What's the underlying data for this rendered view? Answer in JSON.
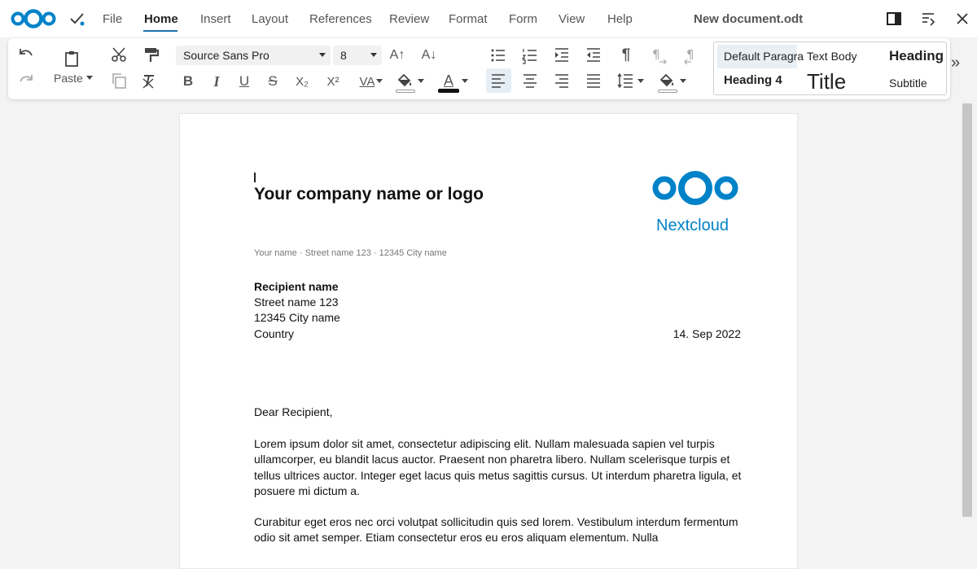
{
  "menubar": {
    "items": [
      {
        "label": "File"
      },
      {
        "label": "Home"
      },
      {
        "label": "Insert"
      },
      {
        "label": "Layout"
      },
      {
        "label": "References"
      },
      {
        "label": "Review"
      },
      {
        "label": "Format"
      },
      {
        "label": "Form"
      },
      {
        "label": "View"
      },
      {
        "label": "Help"
      }
    ],
    "active_tab": "Home",
    "document_title": "New document.odt"
  },
  "toolbar": {
    "paste_label": "Paste",
    "font_name": "Source Sans Pro",
    "font_size": "8",
    "bold_label": "B",
    "italic_label": "I",
    "underline_label": "U",
    "strike_label": "S",
    "subscript_label": "X₂",
    "superscript_label": "X²",
    "spacing_label": "VA",
    "font_color_label": "A",
    "grow_label": "A↑",
    "shrink_label": "A↓",
    "pilcrow_label": "¶"
  },
  "styles": {
    "items": [
      "Default Paragraph",
      "Text Body",
      "Heading",
      "Heading 4",
      "Title",
      "Subtitle"
    ]
  },
  "document": {
    "company": "Your company name or logo",
    "logo_text": "Nextcloud",
    "sender_line": "Your name  ·  Street name 123  ·  12345 City name",
    "recipient": {
      "name": "Recipient name",
      "street": "Street name 123",
      "city": "12345 City name",
      "country": "Country"
    },
    "date": "14. Sep 2022",
    "greeting": "Dear Recipient,",
    "paragraph1": "Lorem ipsum dolor sit amet, consectetur adipiscing elit. Nullam malesuada sapien vel turpis ullamcorper, eu blandit lacus auctor. Praesent non pharetra libero. Nullam scelerisque turpis et tellus ultrices auctor. Integer eget lacus quis metus sagittis cursus. Ut interdum pharetra ligula, et posuere mi dictum a.",
    "paragraph2": "Curabitur eget eros nec orci volutpat sollicitudin quis sed lorem. Vestibulum interdum fermentum odio sit amet semper. Etiam consectetur eros eu eros aliquam elementum. Nulla"
  },
  "colors": {
    "brand": "#0082c9",
    "accent": "#1f6ea8"
  }
}
